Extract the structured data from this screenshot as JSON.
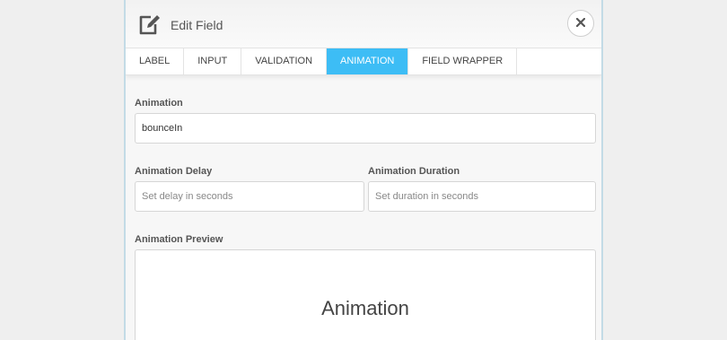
{
  "modal": {
    "title": "Edit Field",
    "edit_icon": "edit-icon",
    "close_icon": "close-icon"
  },
  "tabs": [
    {
      "label": "LABEL",
      "active": false
    },
    {
      "label": "INPUT",
      "active": false
    },
    {
      "label": "VALIDATION",
      "active": false
    },
    {
      "label": "ANIMATION",
      "active": true
    },
    {
      "label": "FIELD WRAPPER",
      "active": false
    }
  ],
  "form": {
    "animation": {
      "label": "Animation",
      "value": "bounceIn"
    },
    "delay": {
      "label": "Animation Delay",
      "placeholder": "Set delay in seconds"
    },
    "duration": {
      "label": "Animation Duration",
      "placeholder": "Set duration in seconds"
    },
    "preview": {
      "label": "Animation Preview",
      "text": "Animation"
    }
  },
  "colors": {
    "accent": "#3dbdf5",
    "modal_border": "#c3dbe6"
  }
}
